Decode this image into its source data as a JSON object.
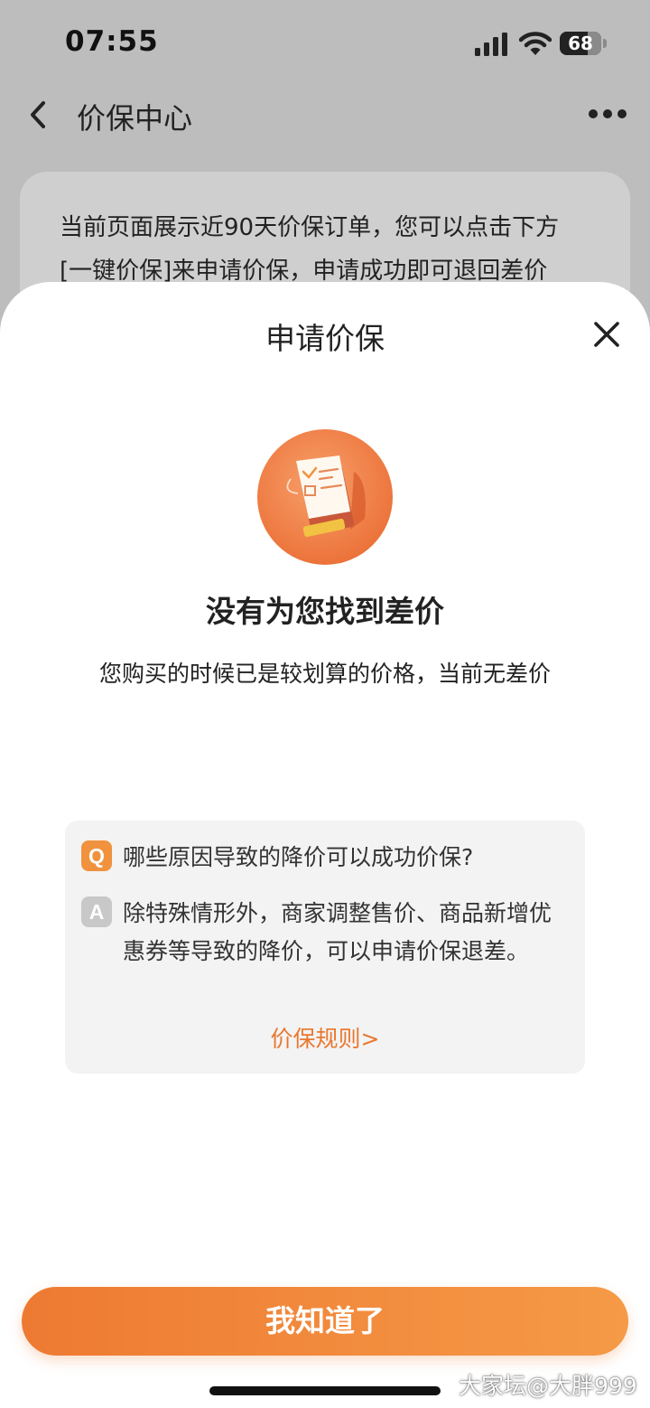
{
  "status_bar": {
    "time": "07:55",
    "battery_level": 68,
    "battery_level_label": "68",
    "icons": [
      "cellular-signal-icon",
      "wifi-icon",
      "battery-icon"
    ]
  },
  "nav": {
    "back_icon": "chevron-left-icon",
    "title": "价保中心",
    "more_icon": "more-dots-icon"
  },
  "notice": {
    "line1": "当前页面展示近90天价保订单，您可以点击下方",
    "line2": "[一键价保]来申请价保，申请成功即可退回差价"
  },
  "sheet": {
    "title": "申请价保",
    "close_icon": "close-icon",
    "illustration": "clipboard-checklist-illustration",
    "headline": "没有为您找到差价",
    "subline": "您购买的时候已是较划算的价格，当前无差价",
    "faq": {
      "q_badge": "Q",
      "question": "哪些原因导致的降价可以成功价保?",
      "a_badge": "A",
      "answer": "除特殊情形外，商家调整售价、商品新增优惠券等导致的降价，可以申请价保退差。",
      "rules_link": "价保规则>"
    },
    "confirm_button": "我知道了"
  },
  "watermark": "大家坛@大胖999",
  "colors": {
    "accent": "#ee7a32",
    "accent_light": "#f59a47",
    "overlay_bg": "#bdbdbd",
    "faq_bg": "#f3f3f3"
  }
}
